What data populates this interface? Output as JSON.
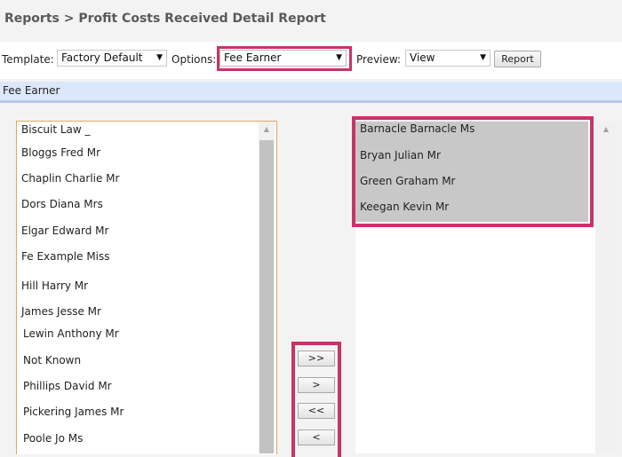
{
  "header": {
    "title": "Reports > Profit Costs Received Detail Report"
  },
  "toolbar": {
    "template_label": "Template:",
    "template_value": "Factory Default",
    "options_label": "Options:",
    "options_value": "Fee Earner",
    "preview_label": "Preview:",
    "preview_value": "View",
    "report_button": "Report"
  },
  "section": {
    "title": "Fee Earner"
  },
  "available_list": {
    "items": [
      "Biscuit Law _",
      "Bloggs Fred Mr",
      "Chaplin Charlie Mr",
      "Dors Diana Mrs",
      "Elgar Edward Mr",
      "Fe Example Miss",
      "Hill Harry Mr",
      "James Jesse Mr",
      "Lewin Anthony Mr",
      "Not Known",
      "Phillips David Mr",
      "Pickering James Mr",
      "Poole Jo Ms"
    ]
  },
  "selected_list": {
    "items": [
      "Barnacle Barnacle Ms",
      "Bryan Julian Mr",
      "Green Graham Mr",
      "Keegan Kevin Mr"
    ]
  },
  "move_buttons": {
    "add_all": ">>",
    "add": ">",
    "remove_all": "<<",
    "remove": "<"
  },
  "colors": {
    "highlight": "#c8336a",
    "section_bg": "#dde7fb",
    "selected_bg": "#c8c8c8"
  }
}
